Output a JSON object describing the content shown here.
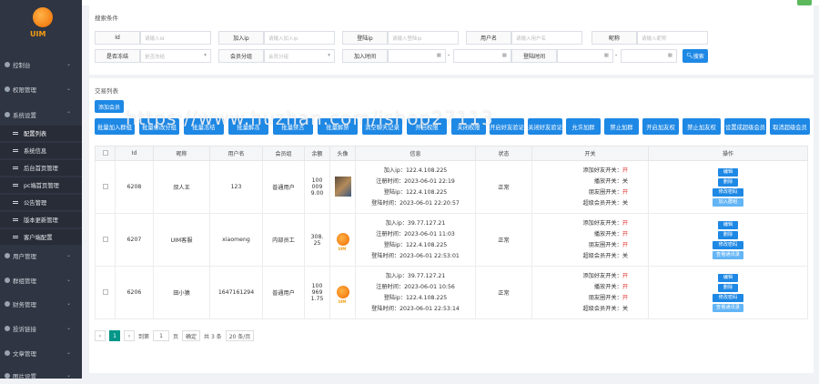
{
  "sidebar": {
    "logo_text": "UIM",
    "menus": [
      {
        "label": "控制台"
      },
      {
        "label": "权限管理"
      },
      {
        "label": "系统设置"
      }
    ],
    "subitems": [
      "配置列表",
      "系统信息",
      "后台首页管理",
      "pc端首页管理",
      "公告管理",
      "版本更新管理",
      "客户端配置"
    ],
    "menus_bottom": [
      {
        "label": "用户管理"
      },
      {
        "label": "群组管理"
      },
      {
        "label": "财务管理"
      },
      {
        "label": "投诉链接"
      },
      {
        "label": "文章管理"
      },
      {
        "label": "图片设置"
      }
    ]
  },
  "search": {
    "title": "搜索条件",
    "fields": [
      {
        "label": "Id",
        "placeholder": "请输入id"
      },
      {
        "label": "加入ip",
        "placeholder": "请输入加入ip"
      },
      {
        "label": "登陆ip",
        "placeholder": "请输入登陆ip"
      },
      {
        "label": "用户名",
        "placeholder": "请输入用户名"
      },
      {
        "label": "昵称",
        "placeholder": "请输入昵称"
      }
    ],
    "row2": [
      {
        "label": "是否冻结",
        "value": "是否冻结"
      },
      {
        "label": "会员分组",
        "value": "会员分组"
      }
    ],
    "join_time_label": "加入时间",
    "login_time_label": "登陆时间",
    "dash": "-",
    "search_btn": "搜索"
  },
  "list": {
    "title": "交易列表",
    "add_btn": "添加会员",
    "actions": [
      "批量加入群组",
      "批量修改分组",
      "批量冻结",
      "批量解冻",
      "批量禁言",
      "批量解禁",
      "清空聊天记录",
      "开启权限",
      "关闭权限",
      "开启好友验证",
      "关闭好友验证",
      "允许加群",
      "禁止加群",
      "开启加友权",
      "禁止加友权",
      "设置成超级会员",
      "取消超级会员"
    ],
    "columns": [
      "",
      "Id",
      "昵称",
      "用户名",
      "会员组",
      "余额",
      "头像",
      "信息",
      "状态",
      "开关",
      "操作"
    ],
    "rows": [
      {
        "id": "6208",
        "nickname": "叔人王",
        "username": "123",
        "group": "普通用户",
        "balance": [
          "100",
          "009",
          "9.00"
        ],
        "info": [
          "加入ip：122.4.108.225",
          "注册时间：2023-06-01 22:19",
          "登陆ip：122.4.108.225",
          "登陆时间：2023-06-01 22:20:57"
        ],
        "status": "正常",
        "switches": [
          [
            "添加好友开关：",
            "开"
          ],
          [
            "播放开关：",
            "关"
          ],
          [
            "朋友圈开关：",
            "开"
          ],
          [
            "超级会员开关：",
            "关"
          ]
        ],
        "ops": [
          "编辑",
          "删除",
          "修改密码",
          "加入群组"
        ]
      },
      {
        "id": "6207",
        "nickname": "UIM客服",
        "username": "xiaomeng",
        "group": "内部员工",
        "balance": [
          "308.",
          "25"
        ],
        "info": [
          "加入ip：39.77.127.21",
          "注册时间：2023-06-01 11:03",
          "登陆ip：122.4.108.225",
          "登陆时间：2023-06-01 22:53:01"
        ],
        "status": "正常",
        "switches": [
          [
            "添加好友开关：",
            "开"
          ],
          [
            "播放开关：",
            "开"
          ],
          [
            "朋友圈开关：",
            "开"
          ],
          [
            "超级会员开关：",
            "关"
          ]
        ],
        "ops": [
          "编辑",
          "删除",
          "修改密码",
          "查看通讯录"
        ]
      },
      {
        "id": "6206",
        "nickname": "田小猿",
        "username": "1647161294",
        "group": "普通用户",
        "balance": [
          "100",
          "969",
          "1.75"
        ],
        "info": [
          "加入ip：39.77.127.21",
          "注册时间：2023-06-01 10:56",
          "登陆ip：122.4.108.225",
          "登陆时间：2023-06-01 22:53:14"
        ],
        "status": "正常",
        "switches": [
          [
            "添加好友开关：",
            "开"
          ],
          [
            "播放开关：",
            "开"
          ],
          [
            "朋友圈开关：",
            "开"
          ],
          [
            "超级会员开关：",
            "关"
          ]
        ],
        "ops": [
          "编辑",
          "删除",
          "修改密码",
          "查看通讯录"
        ]
      }
    ]
  },
  "pager": {
    "current": "1",
    "goto_label": "到第",
    "goto_value": "1",
    "page_unit": "页",
    "confirm": "确定",
    "total": "共 3 条",
    "per_page": "20 条/页"
  },
  "watermark": "https://www.huzhan.com/ishop27113"
}
